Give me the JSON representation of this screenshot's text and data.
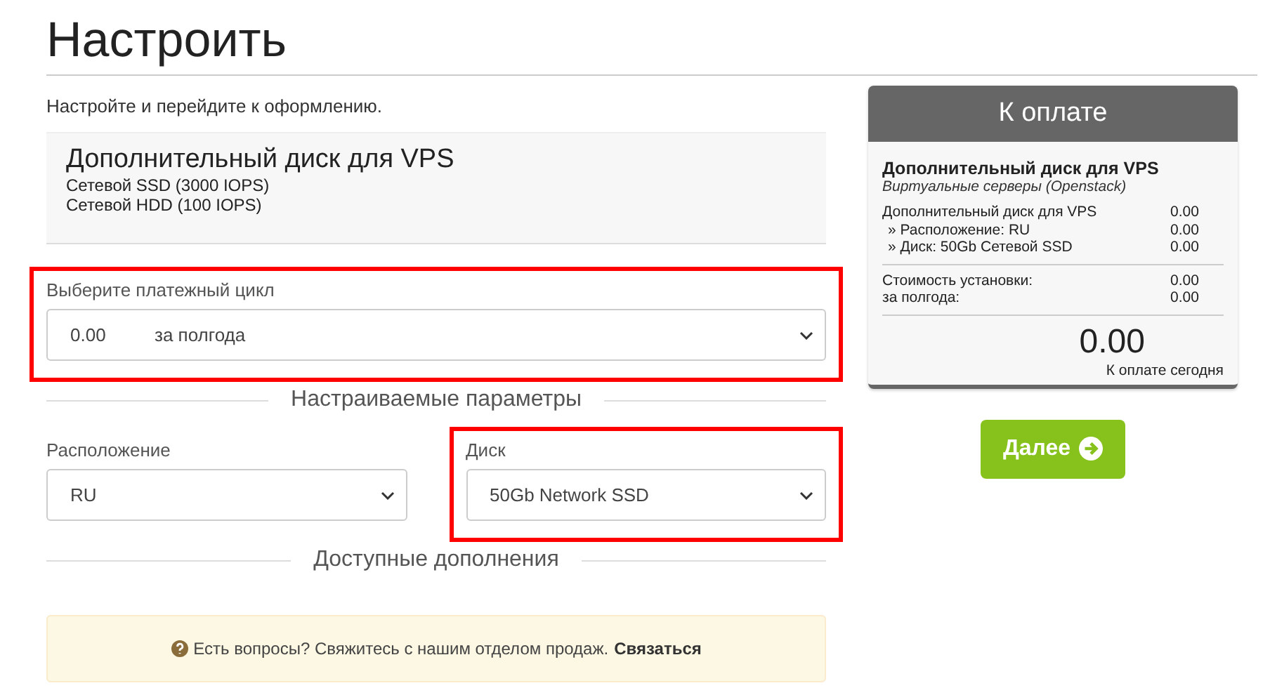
{
  "title": "Настроить",
  "intro": "Настройте и перейдите к оформлению.",
  "product": {
    "name": "Дополнительный диск для VPS",
    "lines": [
      "Сетевой SSD (3000 IOPS)",
      "Сетевой HDD (100 IOPS)"
    ]
  },
  "billing": {
    "label": "Выберите платежный цикл",
    "price": "0.00",
    "period": "за полгода",
    "highlighted": true
  },
  "config_heading": "Настраиваемые параметры",
  "options": [
    {
      "label": "Расположение",
      "value": "RU",
      "highlighted": false
    },
    {
      "label": "Диск",
      "value": "50Gb Network SSD",
      "highlighted": true
    }
  ],
  "addons_heading": "Доступные дополнения",
  "notice": {
    "text": "Есть вопросы? Свяжитесь с нашим отделом продаж.",
    "link": "Связаться"
  },
  "summary": {
    "title": "К оплате",
    "product": "Дополнительный диск для VPS",
    "group": "Виртуальные серверы (Openstack)",
    "items": [
      {
        "label": "Дополнительный диск для VPS",
        "amount": "0.00"
      },
      {
        "label": "» Расположение: RU",
        "amount": "0.00"
      },
      {
        "label": "» Диск: 50Gb Сетевой SSD",
        "amount": "0.00"
      }
    ],
    "fees": [
      {
        "label": "Стоимость установки:",
        "amount": "0.00"
      },
      {
        "label": "за полгода:",
        "amount": "0.00"
      }
    ],
    "total": "0.00",
    "total_label": "К оплате сегодня"
  },
  "continue_button": "Далее"
}
